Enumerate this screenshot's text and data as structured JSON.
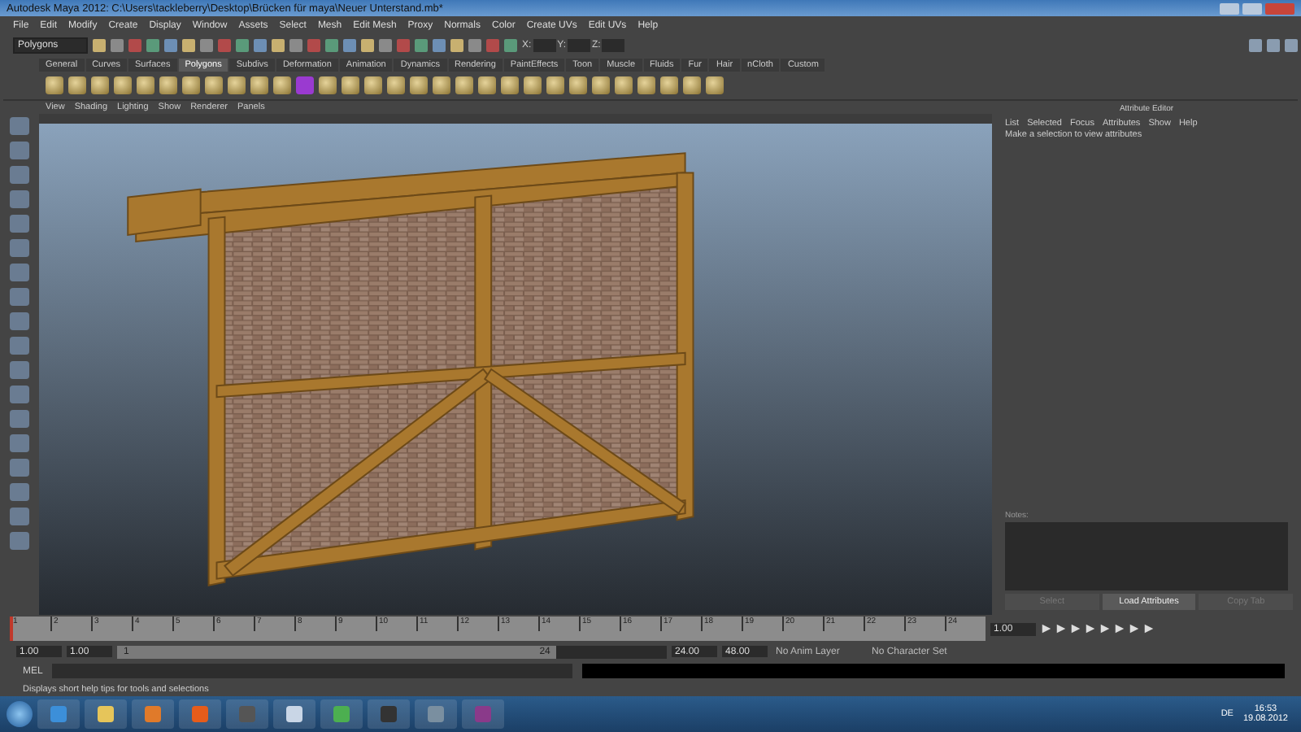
{
  "window": {
    "title": "Autodesk Maya 2012: C:\\Users\\tackleberry\\Desktop\\Brücken für maya\\Neuer Unterstand.mb*"
  },
  "menu": [
    "File",
    "Edit",
    "Modify",
    "Create",
    "Display",
    "Window",
    "Assets",
    "Select",
    "Mesh",
    "Edit Mesh",
    "Proxy",
    "Normals",
    "Color",
    "Create UVs",
    "Edit UVs",
    "Help"
  ],
  "status_line": {
    "mode": "Polygons",
    "x_label": "X:",
    "y_label": "Y:",
    "z_label": "Z:"
  },
  "shelf_tabs": [
    {
      "label": "General",
      "selected": false
    },
    {
      "label": "Curves",
      "selected": false
    },
    {
      "label": "Surfaces",
      "selected": false
    },
    {
      "label": "Polygons",
      "selected": true
    },
    {
      "label": "Subdivs",
      "selected": false
    },
    {
      "label": "Deformation",
      "selected": false
    },
    {
      "label": "Animation",
      "selected": false
    },
    {
      "label": "Dynamics",
      "selected": false
    },
    {
      "label": "Rendering",
      "selected": false
    },
    {
      "label": "PaintEffects",
      "selected": false
    },
    {
      "label": "Toon",
      "selected": false
    },
    {
      "label": "Muscle",
      "selected": false
    },
    {
      "label": "Fluids",
      "selected": false
    },
    {
      "label": "Fur",
      "selected": false
    },
    {
      "label": "Hair",
      "selected": false
    },
    {
      "label": "nCloth",
      "selected": false
    },
    {
      "label": "Custom",
      "selected": false
    }
  ],
  "viewport": {
    "menu": [
      "View",
      "Shading",
      "Lighting",
      "Show",
      "Renderer",
      "Panels"
    ]
  },
  "attribute_editor": {
    "title": "Attribute Editor",
    "menu": [
      "List",
      "Selected",
      "Focus",
      "Attributes",
      "Show",
      "Help"
    ],
    "message": "Make a selection to view attributes",
    "notes_label": "Notes:",
    "buttons": [
      {
        "label": "Select",
        "disabled": true
      },
      {
        "label": "Load Attributes",
        "disabled": false
      },
      {
        "label": "Copy Tab",
        "disabled": true
      }
    ]
  },
  "time_slider": {
    "ticks": [
      "1",
      "2",
      "3",
      "4",
      "5",
      "6",
      "7",
      "8",
      "9",
      "10",
      "11",
      "12",
      "13",
      "14",
      "15",
      "16",
      "17",
      "18",
      "19",
      "20",
      "21",
      "22",
      "23",
      "24"
    ],
    "current_time": "1.00",
    "level": 0
  },
  "range_slider": {
    "start": "1.00",
    "playback_start": "1.00",
    "range_start": "1",
    "range_end": "24",
    "level": 0.8,
    "playback_end": "24.00",
    "end": "48.00",
    "anim_layer": "No Anim Layer",
    "character_set": "No Character Set"
  },
  "command_line": {
    "label": "MEL"
  },
  "help_line": "Displays short help tips for tools and selections",
  "taskbar": {
    "language": "DE",
    "time": "16:53",
    "date": "19.08.2012"
  }
}
